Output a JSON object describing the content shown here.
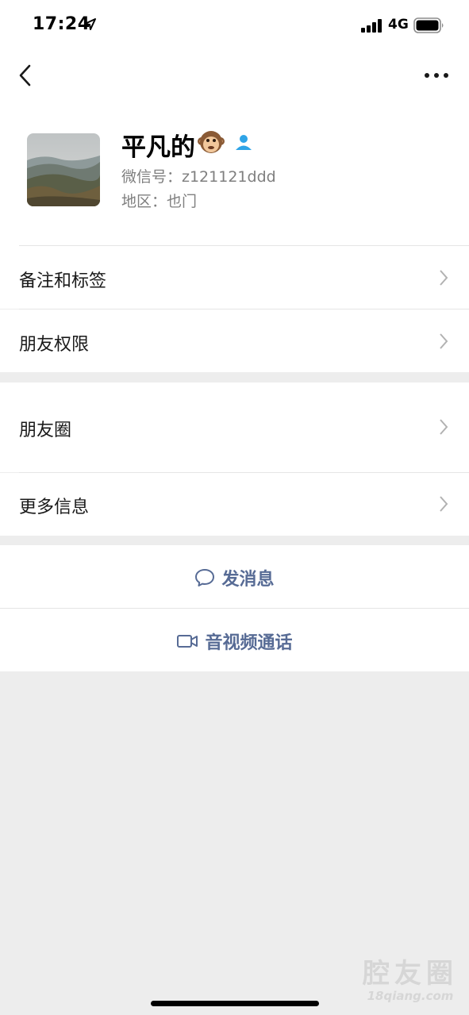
{
  "status_bar": {
    "time": "17:24",
    "network": "4G"
  },
  "profile": {
    "name": "平凡的",
    "name_emoji": "🐵",
    "wechat_id": "微信号：z121121ddd",
    "region": "地区：也门"
  },
  "menu": {
    "remark_tags": "备注和标签",
    "friend_permissions": "朋友权限",
    "moments": "朋友圈",
    "more_info": "更多信息"
  },
  "actions": {
    "send_message": "发消息",
    "video_call": "音视频通话"
  },
  "watermark": {
    "title": "腔友圈",
    "subtitle": "18qiang.com"
  },
  "colors": {
    "link": "#576b95",
    "background": "#ededed",
    "user_icon": "#2fa4e7"
  }
}
